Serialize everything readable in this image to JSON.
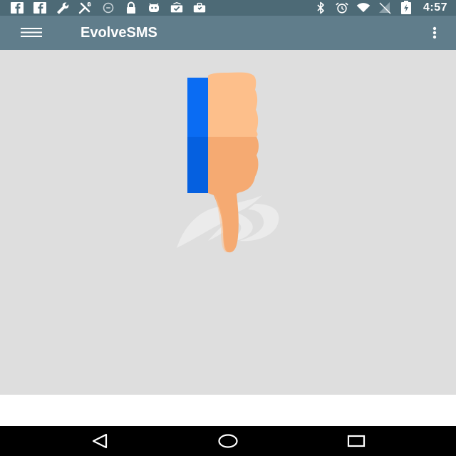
{
  "status_bar": {
    "time": "4:57",
    "notification_icons": [
      "facebook-icon",
      "facebook-icon",
      "wrench-icon",
      "tools-icon",
      "data-saver-icon",
      "lock-icon",
      "android-icon",
      "inbox-check-icon",
      "briefcase-icon"
    ],
    "system_icons": [
      "bluetooth-icon",
      "alarm-icon",
      "wifi-icon",
      "no-signal-icon",
      "battery-charging-icon"
    ]
  },
  "app_bar": {
    "title": "EvolveSMS",
    "menu_icon": "hamburger-icon",
    "overflow_icon": "overflow-menu-icon"
  },
  "content": {
    "illustration": "thumbs-down-sms-illustration"
  },
  "nav_bar": {
    "buttons": [
      "back-icon",
      "home-icon",
      "recents-icon"
    ]
  },
  "colors": {
    "status_bar": "#4d6a76",
    "app_bar": "#607d8b",
    "content_bg": "#dedede",
    "sleeve_blue": "#0a6cf3",
    "skin_light": "#fdbf8b",
    "skin_dark": "#f5aa72",
    "nav_bar": "#000000"
  }
}
